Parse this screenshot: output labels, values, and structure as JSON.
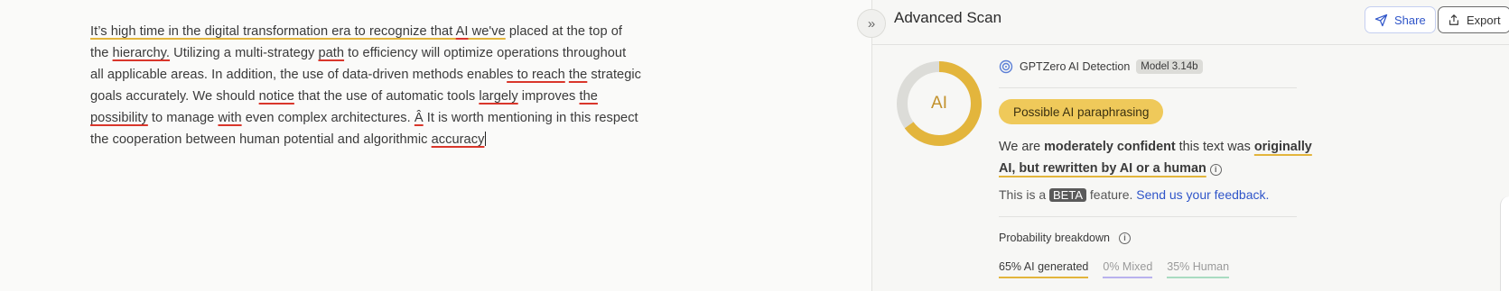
{
  "editor": {
    "lines": [
      [
        {
          "t": "It’s high time in the digital transformation era  to recognize that ",
          "u": "gold"
        },
        {
          "t": "AI",
          "u": "red"
        },
        {
          "t": " we've",
          "u": "gold"
        },
        {
          "t": " placed at the top of",
          "u": ""
        }
      ],
      [
        {
          "t": "the ",
          "u": ""
        },
        {
          "t": "hierarchy.",
          "u": "red"
        },
        {
          "t": " Utilizing a multi-strategy ",
          "u": ""
        },
        {
          "t": "path",
          "u": "red"
        },
        {
          "t": " to efficiency will optimize operations  throughout",
          "u": ""
        }
      ],
      [
        {
          "t": "all applicable areas. In addition, the use  of data-driven methods enable",
          "u": ""
        },
        {
          "t": "s to reach",
          "u": "red"
        },
        {
          "t": " ",
          "u": ""
        },
        {
          "t": "the",
          "u": "red"
        },
        {
          "t": " strategic",
          "u": ""
        }
      ],
      [
        {
          "t": "goals accurately. We should ",
          "u": ""
        },
        {
          "t": "notice",
          "u": "red"
        },
        {
          "t": " that the use  of automatic tools ",
          "u": ""
        },
        {
          "t": "largely",
          "u": "red"
        },
        {
          "t": " improves ",
          "u": ""
        },
        {
          "t": "the",
          "u": "red"
        }
      ],
      [
        {
          "t": "possibility",
          "u": "red"
        },
        {
          "t": " to manage ",
          "u": ""
        },
        {
          "t": "with",
          "u": "red"
        },
        {
          "t": " even complex architectures. ",
          "u": ""
        },
        {
          "t": "Â",
          "u": "red"
        },
        {
          "t": " It is  worth mentioning in this respect",
          "u": ""
        }
      ],
      [
        {
          "t": "the cooperation between human potential and algorithmic ",
          "u": ""
        },
        {
          "t": "accuracy",
          "u": "red"
        }
      ]
    ]
  },
  "panel": {
    "collapse_icon": "double-chevron-right-icon",
    "title": "Advanced Scan",
    "share_label": "Share",
    "export_label": "Export",
    "detector_name": "GPTZero AI Detection",
    "model_label": "Model 3.14b",
    "donut_label": "AI",
    "donut_fraction": 0.65,
    "donut_color": "#e3b53c",
    "result_pill": "Possible AI paraphrasing",
    "confidence": {
      "pre": "We are ",
      "strong": "moderately confident",
      "mid": " this text was ",
      "line1_ul": "originally",
      "line2_ul": "AI, but rewritten by AI or a human"
    },
    "beta": {
      "pre": "This is a ",
      "badge": "BETA",
      "mid": " feature. ",
      "link": "Send us your feedback."
    },
    "probability_title": "Probability breakdown",
    "probabilities": {
      "ai": "65% AI generated",
      "mixed": "0% Mixed",
      "human": "35% Human"
    }
  }
}
